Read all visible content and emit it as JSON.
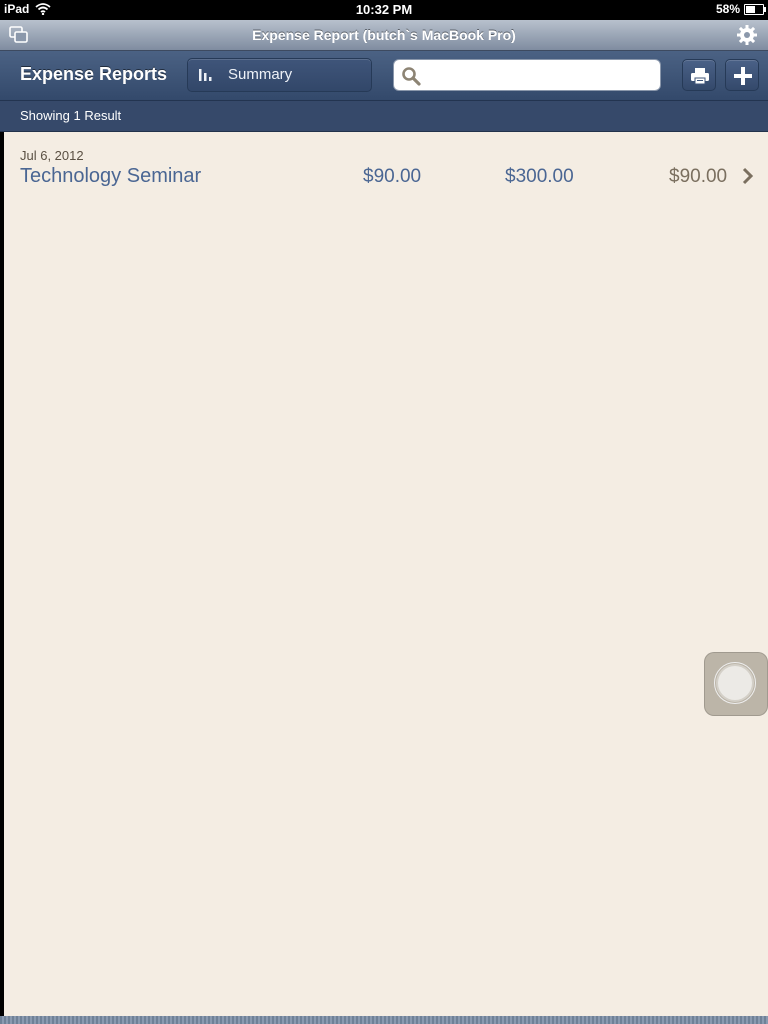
{
  "status_bar": {
    "carrier": "iPad",
    "time": "10:32 PM",
    "battery_percent": "58%",
    "battery_level": 0.58
  },
  "window": {
    "title": "Expense Report (butch`s MacBook Pro)"
  },
  "toolbar": {
    "heading": "Expense Reports",
    "summary_label": "Summary",
    "search_value": "",
    "search_placeholder": ""
  },
  "results": {
    "summary_text": "Showing 1 Result"
  },
  "reports": [
    {
      "date": "Jul 6, 2012",
      "name": "Technology Seminar",
      "amount_1": "$90.00",
      "amount_2": "$300.00",
      "amount_3": "$90.00"
    }
  ],
  "icons": {
    "window": "windows-icon",
    "settings": "gear-icon",
    "summary": "bar-chart-icon",
    "search": "search-icon",
    "print": "printer-icon",
    "add": "plus-icon",
    "row": "chevron-right-icon"
  }
}
